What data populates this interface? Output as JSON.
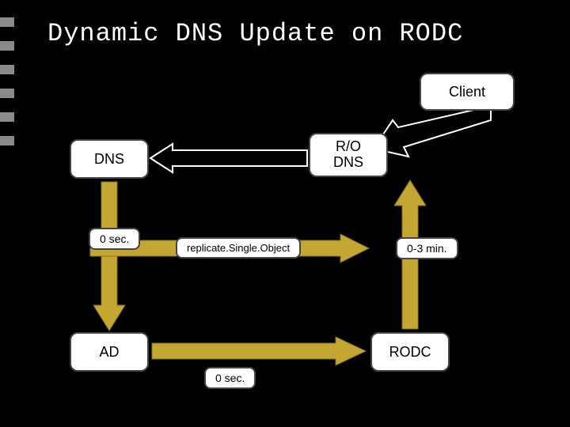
{
  "title": "Dynamic DNS Update on RODC",
  "boxes": {
    "client": "Client",
    "rodns_line1": "R/O",
    "rodns_line2": "DNS",
    "dns": "DNS",
    "ad": "AD",
    "rodc": "RODC"
  },
  "labels": {
    "zero_sec_1": "0 sec.",
    "replicate": "replicate.Single.Object",
    "zero_to_three_min": "0-3 min.",
    "zero_sec_2": "0 sec."
  },
  "chart_data": {
    "type": "diagram",
    "title": "Dynamic DNS Update on RODC",
    "nodes": [
      {
        "id": "client",
        "label": "Client"
      },
      {
        "id": "rodns",
        "label": "R/O DNS"
      },
      {
        "id": "dns",
        "label": "DNS"
      },
      {
        "id": "ad",
        "label": "AD"
      },
      {
        "id": "rodc",
        "label": "RODC"
      }
    ],
    "edges": [
      {
        "from": "client",
        "to": "rodns",
        "label": ""
      },
      {
        "from": "rodns",
        "to": "dns",
        "label": ""
      },
      {
        "from": "dns",
        "to": "ad",
        "label": "0 sec."
      },
      {
        "from": "ad",
        "to": "rodc",
        "label": "replicate.Single.Object / 0 sec."
      },
      {
        "from": "rodc",
        "to": "rodns",
        "label": "0-3 min."
      }
    ]
  }
}
